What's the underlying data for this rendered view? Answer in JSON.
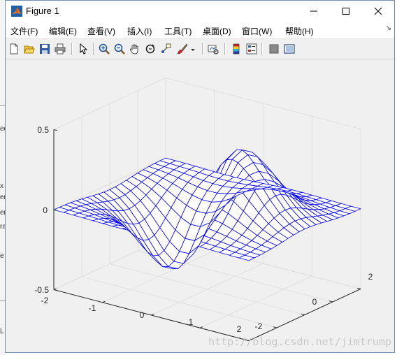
{
  "window": {
    "title": "Figure 1"
  },
  "menu": [
    {
      "id": "file",
      "label": "文件(F)"
    },
    {
      "id": "edit",
      "label": "编辑(E)"
    },
    {
      "id": "view",
      "label": "查看(V)"
    },
    {
      "id": "insert",
      "label": "插入(I)"
    },
    {
      "id": "tools",
      "label": "工具(T)"
    },
    {
      "id": "desktop",
      "label": "桌面(D)"
    },
    {
      "id": "window",
      "label": "窗口(W)"
    },
    {
      "id": "help",
      "label": "帮助(H)"
    }
  ],
  "toolbar": [
    "new-figure-icon",
    "open-file-icon",
    "save-icon",
    "print-icon",
    "select-arrow-icon",
    "zoom-in-icon",
    "zoom-out-icon",
    "pan-hand-icon",
    "rotate-3d-icon",
    "data-cursor-icon",
    "brush-icon",
    "brush-dropdown-icon",
    "link-plot-icon",
    "colorbar-icon",
    "legend-icon",
    "hide-plot-tools-icon",
    "show-plot-tools-icon"
  ],
  "axes": {
    "z_ticks": [
      "0.5",
      "0",
      "-0.5"
    ],
    "x_ticks": [
      "-2",
      "-1",
      "0",
      "1",
      "2"
    ],
    "y_ticks": [
      "-2",
      "0",
      "2"
    ]
  },
  "chart_data": {
    "type": "surface",
    "function": "z = x * exp(-x^2 - y^2)",
    "style": "mesh",
    "x_range": [
      -2,
      2
    ],
    "y_range": [
      -2,
      2
    ],
    "zlim": [
      -0.5,
      0.5
    ],
    "grid_lines": 21,
    "line_color": "#0000ff",
    "grid": true
  },
  "watermark": "http://blog.csdn.net/jimtrump",
  "background_fragments": [
    "ed",
    "x",
    "er",
    "er",
    "ra",
    "e",
    "L"
  ]
}
